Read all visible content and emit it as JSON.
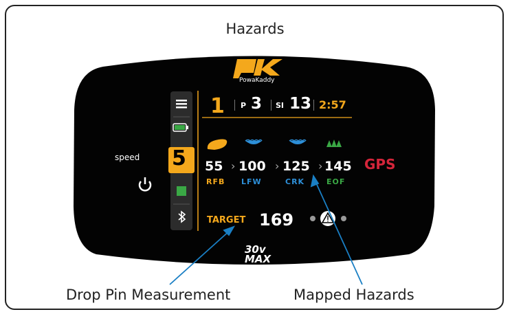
{
  "title": "Hazards",
  "brand": {
    "name": "PowaKaddy",
    "model_top": "30v",
    "model_bottom": "MAX"
  },
  "sidebar": {
    "speed_label": "speed",
    "speed_value": "5",
    "icons": [
      "menu-icon",
      "battery-icon",
      "speed-icon",
      "stop-icon",
      "bluetooth-icon"
    ]
  },
  "status_bar": {
    "hole": "1",
    "par_label": "P",
    "par": "3",
    "si_label": "SI",
    "si": "13",
    "time": "2:57"
  },
  "hazards": [
    {
      "distance": "55",
      "code": "RFB",
      "color": "#f4a81c",
      "icon": "bunker-icon"
    },
    {
      "distance": "100",
      "code": "LFW",
      "color": "#2d8fd8",
      "icon": "water-icon"
    },
    {
      "distance": "125",
      "code": "CRK",
      "color": "#2d8fd8",
      "icon": "water-icon"
    },
    {
      "distance": "145",
      "code": "EOF",
      "color": "#3aa845",
      "icon": "trees-icon"
    }
  ],
  "gps_label": "GPS",
  "target": {
    "label": "TARGET",
    "value": "169"
  },
  "captions": {
    "left": "Drop Pin Measurement",
    "right": "Mapped Hazards"
  },
  "colors": {
    "accent": "#f4a81c",
    "water": "#2d8fd8",
    "trees": "#3aa845",
    "gps": "#d4253a",
    "arrow": "#1a7fc4"
  }
}
